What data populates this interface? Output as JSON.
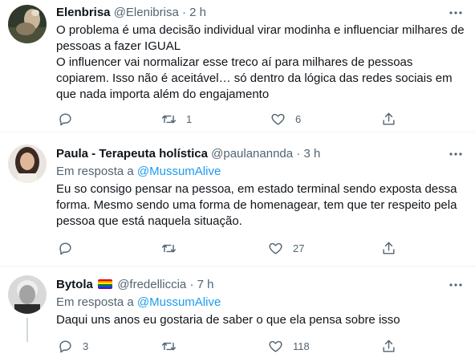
{
  "tweets": [
    {
      "name": "Elenbrisa",
      "handle": "@Elenibrisa",
      "separator": "·",
      "time": "2 h",
      "lines": [
        "O problema é uma decisão individual virar modinha e influenciar milhares de",
        "pessoas a fazer IGUAL",
        "O influencer vai normalizar esse treco aí para milhares de pessoas",
        "copiarem. Isso não é aceitável… só dentro da lógica das redes sociais em",
        "que nada importa além do engajamento"
      ],
      "reply_count": "",
      "retweet_count": "1",
      "like_count": "6"
    },
    {
      "name": "Paula - Terapeuta holística",
      "handle": "@paulanannda",
      "separator": "·",
      "time": "3 h",
      "reply_prefix": "Em resposta a",
      "reply_handle": "@MussumAlive",
      "lines": [
        "Eu so consigo pensar na pessoa, em estado terminal sendo exposta dessa",
        "forma. Mesmo sendo uma forma de homenagear, tem que ter respeito pela",
        "pessoa que está naquela situação."
      ],
      "reply_count": "",
      "retweet_count": "",
      "like_count": "27"
    },
    {
      "name": "Bytola",
      "handle": "@fredelliccia",
      "separator": "·",
      "time": "7 h",
      "reply_prefix": "Em resposta a",
      "reply_handle": "@MussumAlive",
      "lines": [
        "Daqui uns anos eu gostaria de saber o que ela pensa sobre isso"
      ],
      "reply_count": "3",
      "retweet_count": "",
      "like_count": "118"
    }
  ],
  "icons": {
    "more": "more-horizontal-icon",
    "reply": "reply-bubble-icon",
    "retweet": "retweet-icon",
    "like": "heart-icon",
    "share": "share-upload-icon",
    "flag": "rainbow-flag-emoji"
  },
  "colors": {
    "text": "#0f1419",
    "muted": "#536471",
    "link": "#1d9bf0",
    "divider": "#eff3f4"
  }
}
